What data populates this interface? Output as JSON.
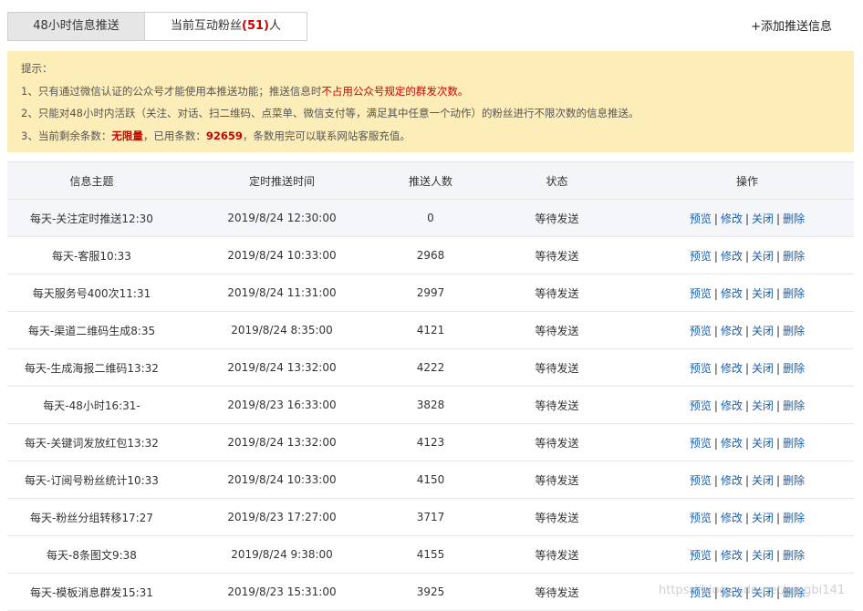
{
  "tabs": [
    {
      "label": "48小时信息推送"
    },
    {
      "label_prefix": "当前互动粉丝",
      "count": "(51)",
      "label_suffix": "人"
    }
  ],
  "add_button": "+添加推送信息",
  "notice": {
    "title": "提示：",
    "line1_a": "1、只有通过微信认证的公众号才能使用本推送功能；推送信息时",
    "line1_red": "不占用公众号规定的群发次数。",
    "line2": "2、只能对48小时内活跃（关注、对话、扫二维码、点菜单、微信支付等，满足其中任意一个动作）的粉丝进行不限次数的信息推送。",
    "line3_a": "3、当前剩余条数：",
    "line3_remaining": "无限量",
    "line3_b": "，已用条数：",
    "line3_used": "92659",
    "line3_c": "，条数用完可以联系网站客服充值。"
  },
  "table": {
    "headers": [
      "信息主题",
      "定时推送时间",
      "推送人数",
      "状态",
      "操作"
    ],
    "ops": [
      "预览",
      "修改",
      "关闭",
      "删除"
    ],
    "rows": [
      {
        "subject": "每天-关注定时推送12:30",
        "time": "2019/8/24 12:30:00",
        "count": "0",
        "status": "等待发送"
      },
      {
        "subject": "每天-客服10:33",
        "time": "2019/8/24 10:33:00",
        "count": "2968",
        "status": "等待发送"
      },
      {
        "subject": "每天服务号400次11:31",
        "time": "2019/8/24 11:31:00",
        "count": "2997",
        "status": "等待发送"
      },
      {
        "subject": "每天-渠道二维码生成8:35",
        "time": "2019/8/24 8:35:00",
        "count": "4121",
        "status": "等待发送"
      },
      {
        "subject": "每天-生成海报二维码13:32",
        "time": "2019/8/24 13:32:00",
        "count": "4222",
        "status": "等待发送"
      },
      {
        "subject": "每天-48小时16:31-",
        "time": "2019/8/23 16:33:00",
        "count": "3828",
        "status": "等待发送"
      },
      {
        "subject": "每天-关键词发放红包13:32",
        "time": "2019/8/24 13:32:00",
        "count": "4123",
        "status": "等待发送"
      },
      {
        "subject": "每天-订阅号粉丝统计10:33",
        "time": "2019/8/24 10:33:00",
        "count": "4150",
        "status": "等待发送"
      },
      {
        "subject": "每天-粉丝分组转移17:27",
        "time": "2019/8/23 17:27:00",
        "count": "3717",
        "status": "等待发送"
      },
      {
        "subject": "每天-8条图文9:38",
        "time": "2019/8/24 9:38:00",
        "count": "4155",
        "status": "等待发送"
      },
      {
        "subject": "每天-模板消息群发15:31",
        "time": "2019/8/23 15:31:00",
        "count": "3925",
        "status": "等待发送"
      }
    ]
  },
  "watermark": "https://blog.csdn.net/qingbi141",
  "colors": {
    "notice_bg": "#fdedb8",
    "status_green": "#1f8a1f",
    "link_blue": "#1c5fa8",
    "alert_red": "#cc0000"
  }
}
